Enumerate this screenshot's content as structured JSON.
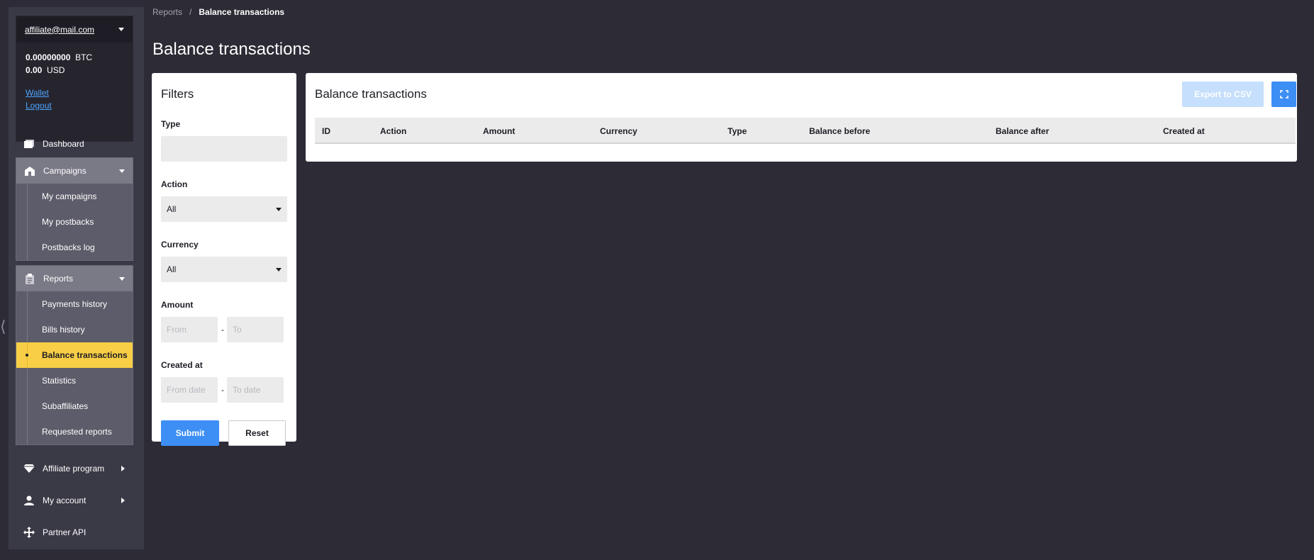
{
  "account": {
    "email": "affiliate@mail.com",
    "btc_amount": "0.00000000",
    "btc_unit": "BTC",
    "usd_amount": "0.00",
    "usd_unit": "USD",
    "wallet_link": "Wallet",
    "logout_link": "Logout"
  },
  "nav": {
    "dashboard": "Dashboard",
    "campaigns": {
      "label": "Campaigns",
      "items": [
        "My campaigns",
        "My postbacks",
        "Postbacks log"
      ]
    },
    "reports": {
      "label": "Reports",
      "items": [
        "Payments history",
        "Bills history",
        "Balance transactions",
        "Statistics",
        "Subaffiliates",
        "Requested reports"
      ],
      "active_index": 2
    },
    "affiliate_program": "Affiliate program",
    "my_account": "My account",
    "partner_api": "Partner API"
  },
  "breadcrumb": {
    "parent": "Reports",
    "separator": "/",
    "current": "Balance transactions"
  },
  "page_title": "Balance transactions",
  "filters": {
    "title": "Filters",
    "type_label": "Type",
    "type_value": "",
    "action_label": "Action",
    "action_value": "All",
    "currency_label": "Currency",
    "currency_value": "All",
    "amount_label": "Amount",
    "amount_from_placeholder": "From",
    "amount_to_placeholder": "To",
    "range_dash": "-",
    "created_label": "Created at",
    "created_from_placeholder": "From date",
    "created_to_placeholder": "To date",
    "submit_label": "Submit",
    "reset_label": "Reset"
  },
  "panel": {
    "title": "Balance transactions",
    "export_label": "Export to CSV",
    "columns": [
      "ID",
      "Action",
      "Amount",
      "Currency",
      "Type",
      "Balance before",
      "Balance after",
      "Created at"
    ]
  },
  "colors": {
    "background": "#2c2b36",
    "sidebar": "#3a3946",
    "accent_blue": "#3d8ff5",
    "active_yellow": "#f7ce46"
  }
}
